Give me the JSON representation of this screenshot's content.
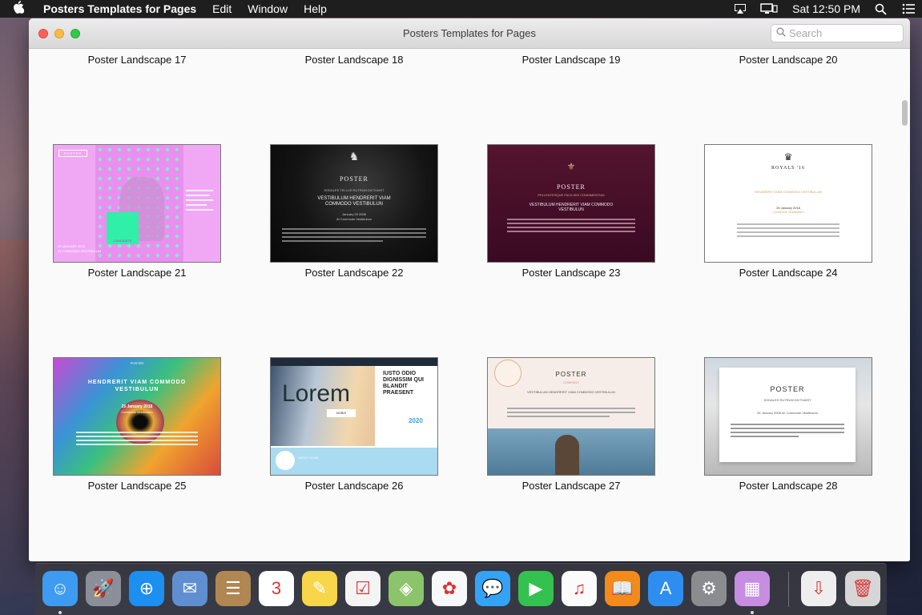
{
  "menubar": {
    "app_name": "Posters Templates for Pages",
    "menus": [
      "Edit",
      "Window",
      "Help"
    ],
    "clock": "Sat 12:50 PM",
    "icons": [
      "apple-icon",
      "airplay-icon",
      "display-icon",
      "spotlight-icon",
      "notification-center-icon"
    ]
  },
  "window": {
    "title": "Posters Templates for Pages",
    "search_placeholder": "Search"
  },
  "row_top_labels": [
    "Poster Landscape 17",
    "Poster Landscape 18",
    "Poster Landscape 19",
    "Poster Landscape 20"
  ],
  "templates": [
    {
      "label": "Poster Landscape 21",
      "thumb_text": {
        "tag": "POSTER",
        "badge": "CANDIDATE",
        "date": "25 JANUARY 2018",
        "venue": "AT COMMODO VESTIBULUM"
      }
    },
    {
      "label": "Poster Landscape 22",
      "thumb_text": {
        "title": "POSTER",
        "sub": "SODALES TELLUS RUTRUM DICTUMST",
        "head": "VESTIBULUM HENDRERIT VIAM COMMODO VESTIBULUN",
        "date": "January 25 2008",
        "venue": "At Commodo Vestibulum"
      }
    },
    {
      "label": "Poster Landscape 23",
      "thumb_text": {
        "title": "POSTER",
        "sub": "PELLENTESQUE FACILISIS CONDIMENTUM",
        "head": "VESTIBULUM HENDRERIT VIAM COMMODO VESTIBULUN"
      }
    },
    {
      "label": "Poster Landscape 24",
      "thumb_text": {
        "title": "ROYALS '16",
        "head": "HENDRERIT VIAM COMMODO VESTIBULUM",
        "date": "25 January 2018",
        "venue": "Commodo Vestibulum"
      }
    },
    {
      "label": "Poster Landscape 25",
      "thumb_text": {
        "tag": "POSTER",
        "head": "HENDRERIT VIAM COMMODO VESTIBULUN",
        "date": "25 January 2018",
        "venue": "Commodo Vestibulum"
      }
    },
    {
      "label": "Poster Landscape 26",
      "thumb_text": {
        "big": "Lorem",
        "head": "IUSTO ODIO DIGNISSIM QUI BLANDIT PRAESENT",
        "year": "2020",
        "tab": "NOBIS",
        "club": "YACHT CLUB"
      }
    },
    {
      "label": "Poster Landscape 27",
      "thumb_text": {
        "title": "POSTER",
        "sub": "COMPANY",
        "head": "VESTIBULUM HENDRERIT VIAM COMMODO VESTIBULUN"
      }
    },
    {
      "label": "Poster Landscape 28",
      "thumb_text": {
        "title": "POSTER",
        "sub": "SODALES RUTRUM DICTUMST",
        "date": "25 January 2008 At: Commodo Vestibulum"
      }
    }
  ],
  "dock": {
    "apps": [
      {
        "name": "finder-icon",
        "glyph": "☺",
        "bg": "#3d9bf2",
        "running": true
      },
      {
        "name": "launchpad-icon",
        "glyph": "🚀",
        "bg": "#8a8f99",
        "running": false
      },
      {
        "name": "safari-icon",
        "glyph": "⊕",
        "bg": "#1c8ff0",
        "running": false
      },
      {
        "name": "mail-icon",
        "glyph": "✉",
        "bg": "#5f8fd0",
        "running": false
      },
      {
        "name": "contacts-icon",
        "glyph": "☰",
        "bg": "#b08652",
        "running": false
      },
      {
        "name": "calendar-icon",
        "glyph": "3",
        "bg": "#ffffff",
        "running": false
      },
      {
        "name": "notes-icon",
        "glyph": "✎",
        "bg": "#f7d64a",
        "running": false
      },
      {
        "name": "reminders-icon",
        "glyph": "☑",
        "bg": "#f4f4f4",
        "running": false
      },
      {
        "name": "maps-icon",
        "glyph": "◈",
        "bg": "#8cc46b",
        "running": false
      },
      {
        "name": "photos-icon",
        "glyph": "✿",
        "bg": "#f8f8f8",
        "running": false
      },
      {
        "name": "messages-icon",
        "glyph": "💬",
        "bg": "#34a3f5",
        "running": false
      },
      {
        "name": "facetime-icon",
        "glyph": "▶",
        "bg": "#35c14f",
        "running": false
      },
      {
        "name": "itunes-icon",
        "glyph": "♫",
        "bg": "#fbfbfb",
        "running": false
      },
      {
        "name": "ibooks-icon",
        "glyph": "📖",
        "bg": "#f28a1c",
        "running": false
      },
      {
        "name": "app-store-icon",
        "glyph": "A",
        "bg": "#2d8ef0",
        "running": false
      },
      {
        "name": "system-preferences-icon",
        "glyph": "⚙",
        "bg": "#8a8c90",
        "running": false
      },
      {
        "name": "posters-templates-app-icon",
        "glyph": "▦",
        "bg": "#c78de0",
        "running": true
      },
      {
        "name": "downloads-stack-icon",
        "glyph": "⇩",
        "bg": "#eeeeee",
        "running": false
      },
      {
        "name": "trash-icon",
        "glyph": "🗑",
        "bg": "#d6d6d6",
        "running": false
      }
    ]
  }
}
